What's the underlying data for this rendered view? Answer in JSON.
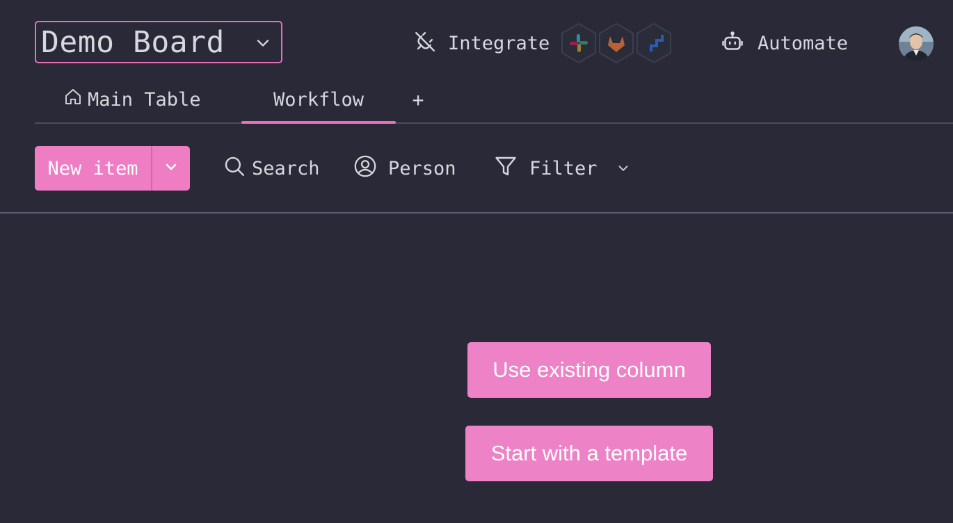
{
  "header": {
    "board_title": "Demo Board",
    "integrate_label": "Integrate",
    "integrations": [
      "slack-icon",
      "gitlab-icon",
      "jira-icon"
    ],
    "automate_label": "Automate"
  },
  "tabs": {
    "main_table": "Main Table",
    "workflow": "Workflow",
    "add": "+",
    "active": "Workflow"
  },
  "toolbar": {
    "new_item": "New item",
    "search": "Search",
    "person": "Person",
    "filter": "Filter"
  },
  "main": {
    "use_existing_column": "Use existing column",
    "start_with_template": "Start with a template"
  },
  "colors": {
    "background": "#292937",
    "accent": "#ee7dc4",
    "text": "#d5d8df"
  }
}
